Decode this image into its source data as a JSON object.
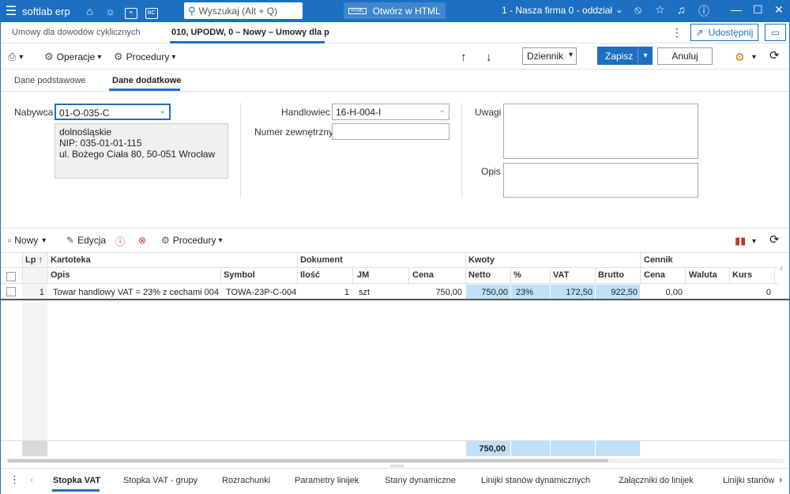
{
  "titlebar": {
    "brand": "softlab erp",
    "search_placeholder": "Wyszukaj (Alt + Q)",
    "open_html_label": "Otwórz w HTML",
    "html_badge": "HTML",
    "bc_badge": "BC",
    "company": "1 - Nasza firma 0 - oddział"
  },
  "doc_tabs": {
    "tab1": "Umowy dla dowodów cyklicznych",
    "tab2": "010, UPODW, 0 – Nowy – Umowy dla p",
    "share_label": "Udostępnij"
  },
  "toolbar": {
    "operacje": "Operacje",
    "procedury": "Procedury",
    "dziennik": "Dziennik",
    "zapisz": "Zapisz",
    "anuluj": "Anuluj"
  },
  "subtabs": {
    "basic": "Dane podstawowe",
    "extra": "Dane dodatkowe"
  },
  "form": {
    "nabywca_label": "Nabywca",
    "nabywca_value": "01-O-035-C",
    "address_line1": "dolnośląskie",
    "address_line2": "NIP: 035-01-01-115",
    "address_line3": "ul. Bożego Ciała 80, 50-051 Wrocław",
    "handlowiec_label": "Handlowiec",
    "handlowiec_value": "16-H-004-I",
    "numer_label": "Numer zewnętrzny",
    "numer_value": "",
    "uwagi_label": "Uwagi",
    "opis_label": "Opis"
  },
  "grid_toolbar": {
    "nowy": "Nowy",
    "edycja": "Edycja",
    "procedury": "Procedury"
  },
  "grid": {
    "group_headers": {
      "lp": "Lp",
      "kartoteka": "Kartoteka",
      "dokument": "Dokument",
      "kwoty": "Kwoty",
      "cennik": "Cennik"
    },
    "columns": {
      "opis": "Opis",
      "symbol": "Symbol",
      "ilosc": "Ilość",
      "jm": "JM",
      "cena": "Cena",
      "netto": "Netto",
      "proc": "%",
      "vat": "VAT",
      "brutto": "Brutto",
      "cennik_cena": "Cena",
      "waluta": "Waluta",
      "kurs": "Kurs"
    },
    "rows": [
      {
        "lp": "1",
        "opis": "Towar handlowy VAT = 23% z cechami 004",
        "symbol": "TOWA-23P-C-004",
        "ilosc": "1",
        "jm": "szt",
        "cena": "750,00",
        "netto": "750,00",
        "proc": "23%",
        "vat": "172,50",
        "brutto": "922,50",
        "cennik_cena": "0,00",
        "waluta": "",
        "kurs": "0"
      }
    ],
    "footer_netto": "750,00"
  },
  "bottom_tabs": {
    "t1": "Stopka VAT",
    "t2": "Stopka VAT - grupy",
    "t3": "Rozrachunki",
    "t4": "Parametry linijek",
    "t5": "Stany dynamiczne",
    "t6": "Linijki stanów dynamicznych",
    "t7": "Załączniki do linijek",
    "t8": "Linijki stanów"
  },
  "colors": {
    "accent": "#1d6fc1",
    "highlight": "#bfe0f7"
  }
}
